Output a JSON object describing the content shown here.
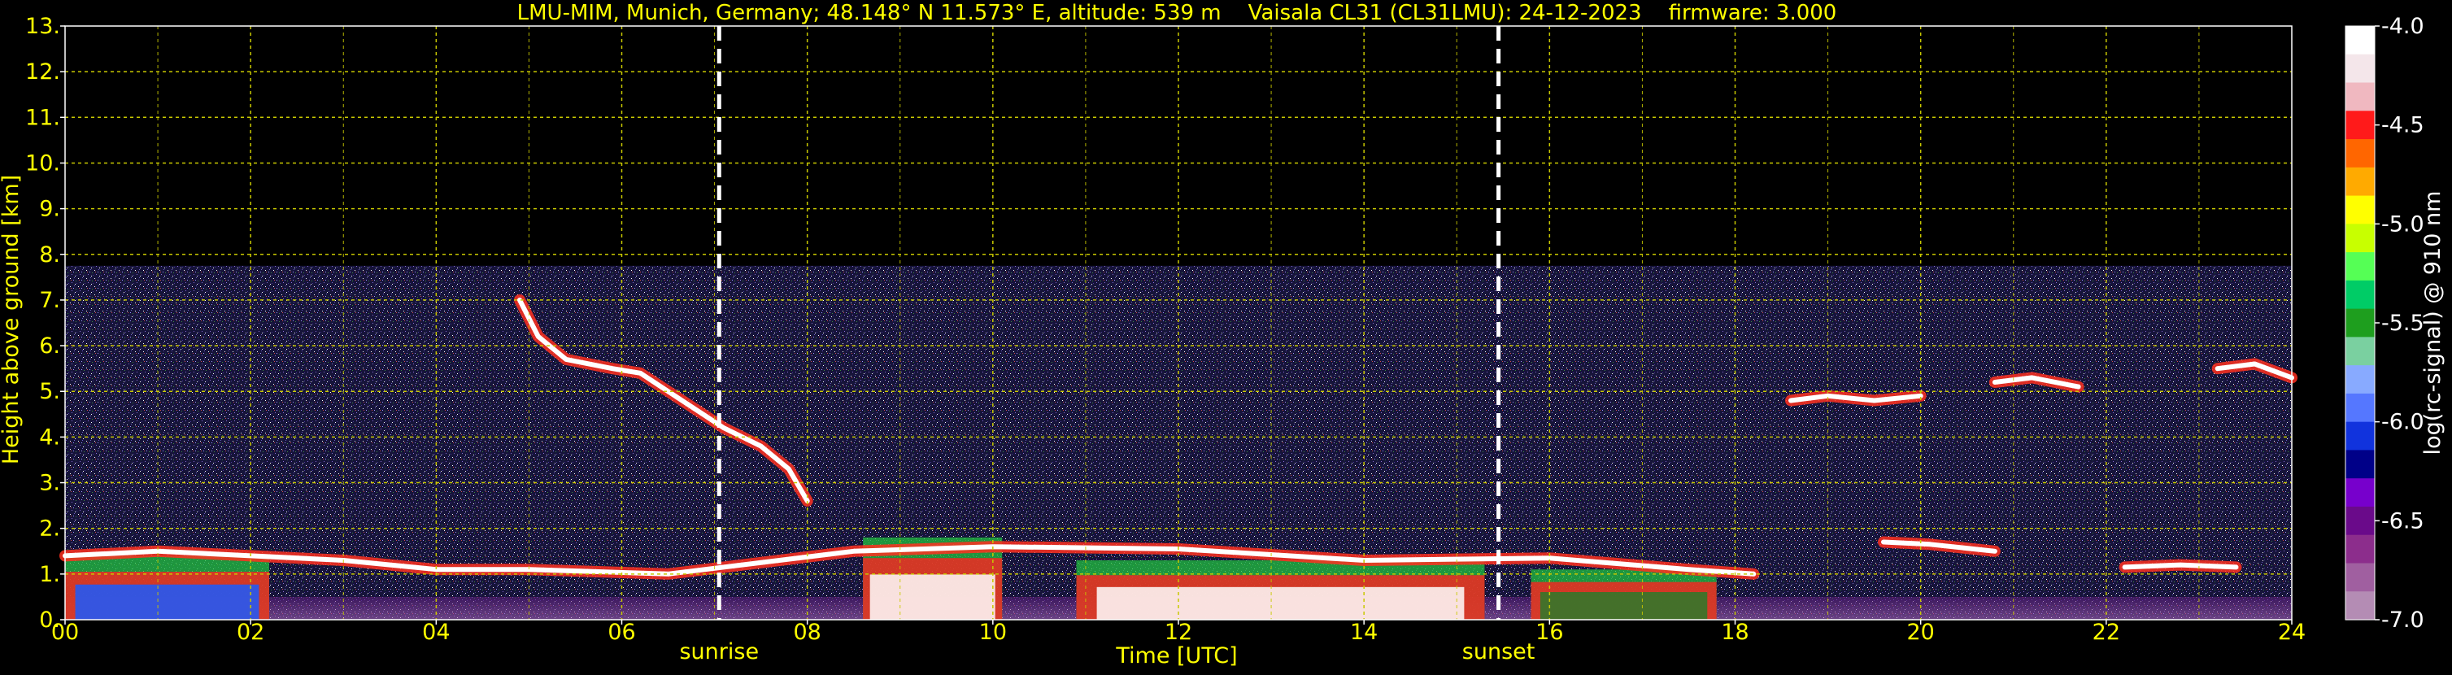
{
  "chart_data": {
    "type": "heatmap",
    "title": "LMU-MIM, Munich, Germany; 48.148° N 11.573° E, altitude: 539 m    Vaisala CL31 (CL31LMU): 24-12-2023    firmware: 3.000",
    "xlabel": "Time [UTC]",
    "ylabel": "Height above ground [km]",
    "xlim": [
      0,
      24
    ],
    "ylim": [
      0,
      13
    ],
    "x_ticks": [
      "00",
      "02",
      "04",
      "06",
      "08",
      "10",
      "12",
      "14",
      "16",
      "18",
      "20",
      "22",
      "24"
    ],
    "y_ticks": [
      "0.",
      "1.",
      "2.",
      "3.",
      "4.",
      "5.",
      "6.",
      "7.",
      "8.",
      "9.",
      "10.",
      "11.",
      "12.",
      "13."
    ],
    "grid": true,
    "colorbar": {
      "label": "log(rc-signal) @ 910 nm",
      "range": [
        -7.0,
        -4.0
      ],
      "ticks": [
        "-4.0",
        "-4.5",
        "-5.0",
        "-5.5",
        "-6.0",
        "-6.5",
        "-7.0"
      ]
    },
    "annotations": [
      {
        "label": "sunrise",
        "x": 7.05
      },
      {
        "label": "sunset",
        "x": 15.45
      }
    ],
    "noise_top_km": 7.75,
    "cloud_layers": [
      {
        "name": "descending-layer",
        "points": [
          [
            4.9,
            7.0
          ],
          [
            5.1,
            6.2
          ],
          [
            5.4,
            5.7
          ],
          [
            5.9,
            5.5
          ],
          [
            6.2,
            5.4
          ],
          [
            6.5,
            5.0
          ],
          [
            6.8,
            4.6
          ],
          [
            7.1,
            4.2
          ],
          [
            7.5,
            3.8
          ],
          [
            7.8,
            3.3
          ],
          [
            8.0,
            2.6
          ]
        ]
      },
      {
        "name": "boundary-layer-top",
        "points": [
          [
            0,
            1.4
          ],
          [
            1.0,
            1.5
          ],
          [
            2.0,
            1.4
          ],
          [
            3.0,
            1.3
          ],
          [
            4.0,
            1.1
          ],
          [
            5.0,
            1.1
          ],
          [
            6.5,
            1.0
          ],
          [
            8.5,
            1.5
          ],
          [
            10.0,
            1.6
          ],
          [
            12.0,
            1.55
          ],
          [
            14.0,
            1.3
          ],
          [
            16.0,
            1.35
          ],
          [
            17.5,
            1.1
          ],
          [
            18.2,
            1.0
          ]
        ]
      },
      {
        "name": "mid-cloud-19h",
        "points": [
          [
            18.6,
            4.8
          ],
          [
            19.0,
            4.9
          ],
          [
            19.5,
            4.8
          ],
          [
            20.0,
            4.9
          ]
        ]
      },
      {
        "name": "mid-cloud-21h",
        "points": [
          [
            20.8,
            5.2
          ],
          [
            21.2,
            5.3
          ],
          [
            21.7,
            5.1
          ]
        ]
      },
      {
        "name": "mid-cloud-23h",
        "points": [
          [
            23.2,
            5.5
          ],
          [
            23.6,
            5.6
          ],
          [
            24.0,
            5.3
          ]
        ]
      },
      {
        "name": "low-cloud-20h",
        "points": [
          [
            19.6,
            1.7
          ],
          [
            20.1,
            1.65
          ],
          [
            20.8,
            1.5
          ]
        ]
      },
      {
        "name": "low-cloud-22h",
        "points": [
          [
            22.2,
            1.15
          ],
          [
            22.8,
            1.2
          ],
          [
            23.4,
            1.15
          ]
        ]
      }
    ],
    "strong_echo_regions": [
      {
        "x": [
          0.0,
          2.2
        ],
        "y": [
          0.0,
          1.4
        ]
      },
      {
        "x": [
          8.6,
          10.1
        ],
        "y": [
          0.0,
          1.8
        ]
      },
      {
        "x": [
          10.9,
          15.3
        ],
        "y": [
          0.0,
          1.3
        ]
      },
      {
        "x": [
          15.8,
          17.8
        ],
        "y": [
          0.0,
          1.1
        ]
      }
    ],
    "colors": {
      "background": "#000000",
      "text": "#ffff00",
      "grid": "#c8c800",
      "colorbar": [
        "#ffffff",
        "#f4e6ea",
        "#f0b8c0",
        "#ff1a1a",
        "#ff6600",
        "#ffaa00",
        "#ffff00",
        "#c8ff00",
        "#55ff55",
        "#00cc66",
        "#1e9e1e",
        "#7ad0a0",
        "#88aaff",
        "#5577ff",
        "#1133dd",
        "#000088",
        "#7700cc",
        "#6a0a8a",
        "#8c2d8c",
        "#a05fa0",
        "#b48cb4"
      ]
    }
  }
}
